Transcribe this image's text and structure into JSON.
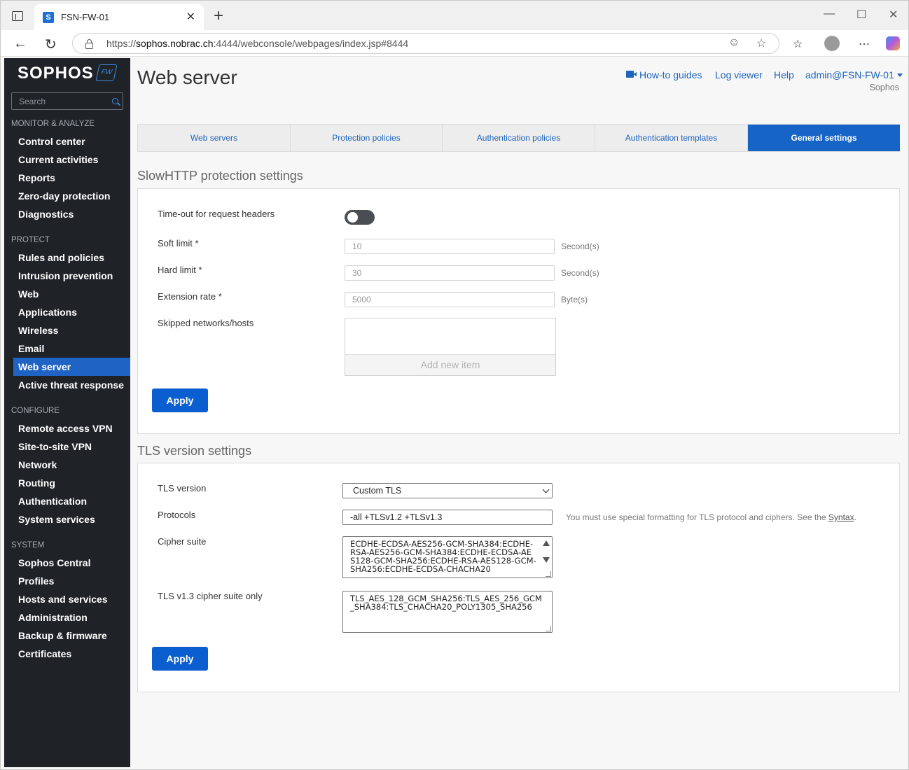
{
  "browser": {
    "tab_title": "FSN-FW-01",
    "favicon_letter": "S",
    "url_prefix": "https://",
    "url_host": "sophos.nobrac.ch",
    "url_rest": ":4444/webconsole/webpages/index.jsp#8444"
  },
  "sidebar": {
    "logo": "SOPHOS",
    "badge": "FW",
    "search_placeholder": "Search",
    "sections": {
      "monitor": "MONITOR & ANALYZE",
      "protect": "PROTECT",
      "configure": "CONFIGURE",
      "system": "SYSTEM"
    },
    "items": {
      "control_center": "Control center",
      "current_activities": "Current activities",
      "reports": "Reports",
      "zero_day": "Zero-day protection",
      "diagnostics": "Diagnostics",
      "rules": "Rules and policies",
      "ips": "Intrusion prevention",
      "web": "Web",
      "applications": "Applications",
      "wireless": "Wireless",
      "email": "Email",
      "web_server": "Web server",
      "active_threat": "Active threat response",
      "remote_vpn": "Remote access VPN",
      "s2s_vpn": "Site-to-site VPN",
      "network": "Network",
      "routing": "Routing",
      "authentication": "Authentication",
      "system_services": "System services",
      "sophos_central": "Sophos Central",
      "profiles": "Profiles",
      "hosts_services": "Hosts and services",
      "administration": "Administration",
      "backup": "Backup & firmware",
      "certificates": "Certificates"
    }
  },
  "header": {
    "title": "Web server",
    "howto": "How-to guides",
    "log_viewer": "Log viewer",
    "help": "Help",
    "admin": "admin@FSN-FW-01",
    "org": "Sophos"
  },
  "tabs": {
    "web_servers": "Web servers",
    "protection_policies": "Protection policies",
    "auth_policies": "Authentication policies",
    "auth_templates": "Authentication templates",
    "general_settings": "General settings"
  },
  "slowhttp": {
    "title": "SlowHTTP protection settings",
    "timeout_label": "Time-out for request headers",
    "soft_label": "Soft limit *",
    "soft_value": "10",
    "soft_unit": "Second(s)",
    "hard_label": "Hard limit *",
    "hard_value": "30",
    "hard_unit": "Second(s)",
    "ext_label": "Extension rate *",
    "ext_value": "5000",
    "ext_unit": "Byte(s)",
    "skipped_label": "Skipped networks/hosts",
    "add_item": "Add new item",
    "apply": "Apply"
  },
  "tls": {
    "title": "TLS version settings",
    "version_label": "TLS version",
    "version_value": "Custom TLS",
    "protocols_label": "Protocols",
    "protocols_value": "-all +TLSv1.2 +TLSv1.3",
    "hint_text": "You must use special formatting for TLS protocol and ciphers. See the ",
    "hint_link": "Syntax",
    "hint_end": ".",
    "cipher_label": "Cipher suite",
    "cipher_value": "ECDHE-ECDSA-AES256-GCM-SHA384:ECDHE-RSA-AES256-GCM-SHA384:ECDHE-ECDSA-AES128-GCM-SHA256:ECDHE-RSA-AES128-GCM-SHA256:ECDHE-ECDSA-CHACHA20",
    "tls13_label": "TLS v1.3 cipher suite only",
    "tls13_value": "TLS_AES_128_GCM_SHA256:TLS_AES_256_GCM_SHA384:TLS_CHACHA20_POLY1305_SHA256",
    "apply": "Apply"
  },
  "colors": {
    "sidebar_bg": "#1f2227",
    "accent": "#1764c7",
    "link": "#1e64bf"
  }
}
